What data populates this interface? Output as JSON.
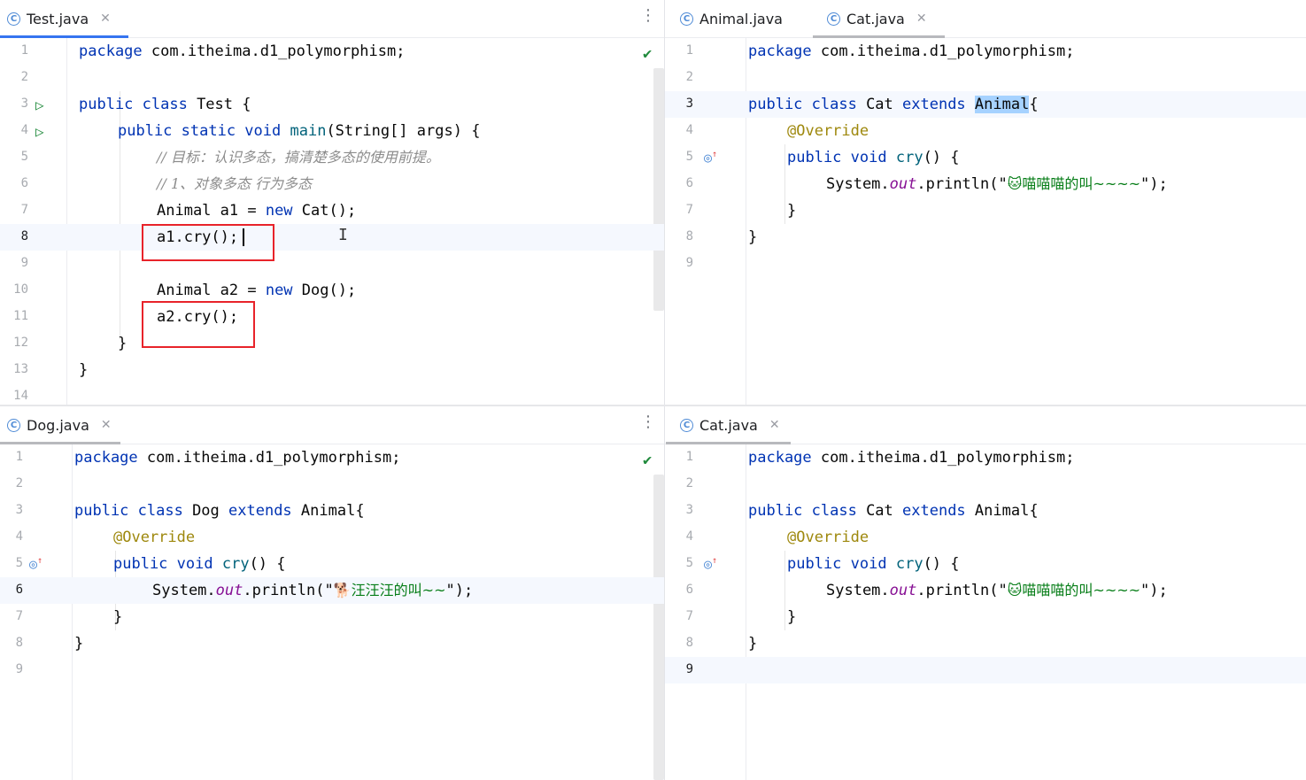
{
  "panes": {
    "top_left": {
      "tabs": [
        {
          "label": "Test.java",
          "closable": true,
          "active": true
        }
      ],
      "lines": [
        "1",
        "2",
        "3",
        "4",
        "5",
        "6",
        "7",
        "8",
        "9",
        "10",
        "11",
        "12",
        "13",
        "14"
      ],
      "code": {
        "l1_kw": "package",
        "l1_rest": " com.itheima.d1_polymorphism;",
        "l3_kw": "public class",
        "l3_rest": " Test {",
        "l4_kw": "public static void",
        "l4_m": "main",
        "l4_rest": "(String[] args) {",
        "l5": "// 目标：认识多态，搞清楚多态的使用前提。",
        "l6": "// 1、对象多态 行为多态",
        "l7_a": "Animal a1 = ",
        "l7_kw": "new",
        "l7_b": " Cat();",
        "l8": "a1.cry();",
        "l10_a": "Animal a2 = ",
        "l10_kw": "new",
        "l10_b": " Dog();",
        "l11": "a2.cry();",
        "l12": "}",
        "l13": "}"
      }
    },
    "top_right": {
      "tabs": [
        {
          "label": "Animal.java",
          "closable": false,
          "active": false
        },
        {
          "label": "Cat.java",
          "closable": true,
          "active": true
        }
      ],
      "lines": [
        "1",
        "2",
        "3",
        "4",
        "5",
        "6",
        "7",
        "8",
        "9"
      ],
      "code": {
        "l1_kw": "package",
        "l1_rest": " com.itheima.d1_polymorphism;",
        "l3_kw": "public class",
        "l3_mid": " Cat ",
        "l3_kw2": "extends",
        "l3_hl": "Animal",
        "l3_end": "{",
        "l4": "@Override",
        "l5_kw": "public void",
        "l5_m": "cry",
        "l5_rest": "() {",
        "l6_a": "System.",
        "l6_f": "out",
        "l6_b": ".println(\"",
        "l6_s": "🐱喵喵喵的叫~~~~",
        "l6_c": "\");",
        "l7": "}",
        "l8": "}"
      }
    },
    "bottom_left": {
      "tabs": [
        {
          "label": "Dog.java",
          "closable": true,
          "active": true
        }
      ],
      "lines": [
        "1",
        "2",
        "3",
        "4",
        "5",
        "6",
        "7",
        "8",
        "9"
      ],
      "code": {
        "l1_kw": "package",
        "l1_rest": " com.itheima.d1_polymorphism;",
        "l3_kw": "public class",
        "l3_mid": " Dog ",
        "l3_kw2": "extends",
        "l3_end": " Animal{",
        "l4": "@Override",
        "l5_kw": "public void",
        "l5_m": "cry",
        "l5_rest": "() {",
        "l6_a": "System.",
        "l6_f": "out",
        "l6_b": ".println(\"",
        "l6_s": "🐕汪汪汪的叫~~",
        "l6_c": "\");",
        "l7": "}",
        "l8": "}"
      }
    },
    "bottom_right": {
      "tabs": [
        {
          "label": "Cat.java",
          "closable": true,
          "active": true
        }
      ],
      "lines": [
        "1",
        "2",
        "3",
        "4",
        "5",
        "6",
        "7",
        "8",
        "9"
      ],
      "code": {
        "l1_kw": "package",
        "l1_rest": " com.itheima.d1_polymorphism;",
        "l3_kw": "public class",
        "l3_mid": " Cat ",
        "l3_kw2": "extends",
        "l3_end": " Animal{",
        "l4": "@Override",
        "l5_kw": "public void",
        "l5_m": "cry",
        "l5_rest": "() {",
        "l6_a": "System.",
        "l6_f": "out",
        "l6_b": ".println(\"",
        "l6_s": "🐱喵喵喵的叫~~~~",
        "l6_c": "\");",
        "l7": "}",
        "l8": "}"
      }
    }
  },
  "icons": {
    "class_file": "c-circle-icon",
    "close": "close-icon",
    "more": "kebab-menu-icon",
    "run": "run-gutter-icon",
    "override": "override-gutter-icon",
    "ok": "check-icon"
  },
  "colors": {
    "keyword": "#0033b3",
    "annotation": "#9e880d",
    "string": "#067d17",
    "comment": "#8c8c8c",
    "highlight": "#a6d2ff",
    "annotation_box": "#e8232a",
    "active_tab_underline": "#3574f0"
  }
}
